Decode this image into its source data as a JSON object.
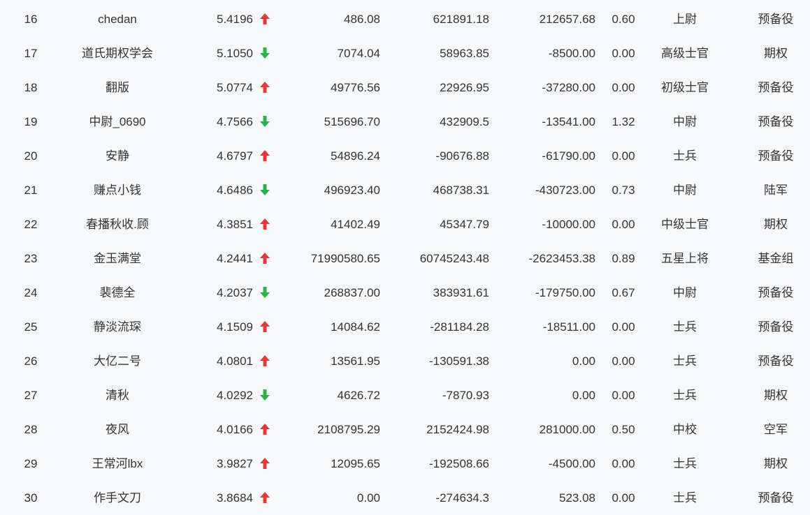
{
  "colors": {
    "up": "#e03a3a",
    "down": "#2bb34a",
    "text": "#333333",
    "background": "#f7f8fa"
  },
  "rows": [
    {
      "rank": "16",
      "name": "chedan",
      "score": "5.4196",
      "trend": "up",
      "v1": "486.08",
      "v2": "621891.18",
      "v3": "212657.68",
      "ratio": "0.60",
      "level": "上尉",
      "group": "预备役"
    },
    {
      "rank": "17",
      "name": "道氏期权学会",
      "score": "5.1050",
      "trend": "down",
      "v1": "7074.04",
      "v2": "58963.85",
      "v3": "-8500.00",
      "ratio": "0.00",
      "level": "高级士官",
      "group": "期权"
    },
    {
      "rank": "18",
      "name": "翻版",
      "score": "5.0774",
      "trend": "up",
      "v1": "49776.56",
      "v2": "22926.95",
      "v3": "-37280.00",
      "ratio": "0.00",
      "level": "初级士官",
      "group": "预备役"
    },
    {
      "rank": "19",
      "name": "中尉_0690",
      "score": "4.7566",
      "trend": "down",
      "v1": "515696.70",
      "v2": "432909.5",
      "v3": "-13541.00",
      "ratio": "1.32",
      "level": "中尉",
      "group": "预备役"
    },
    {
      "rank": "20",
      "name": "安静",
      "score": "4.6797",
      "trend": "up",
      "v1": "54896.24",
      "v2": "-90676.88",
      "v3": "-61790.00",
      "ratio": "0.00",
      "level": "士兵",
      "group": "预备役"
    },
    {
      "rank": "21",
      "name": "赚点小钱",
      "score": "4.6486",
      "trend": "down",
      "v1": "496923.40",
      "v2": "468738.31",
      "v3": "-430723.00",
      "ratio": "0.73",
      "level": "中尉",
      "group": "陆军"
    },
    {
      "rank": "22",
      "name": "春播秋收.顾",
      "score": "4.3851",
      "trend": "up",
      "v1": "41402.49",
      "v2": "45347.79",
      "v3": "-10000.00",
      "ratio": "0.00",
      "level": "中级士官",
      "group": "期权"
    },
    {
      "rank": "23",
      "name": "金玉满堂",
      "score": "4.2441",
      "trend": "up",
      "v1": "71990580.65",
      "v2": "60745243.48",
      "v3": "-2623453.38",
      "ratio": "0.89",
      "level": "五星上将",
      "group": "基金组"
    },
    {
      "rank": "24",
      "name": "裴德全",
      "score": "4.2037",
      "trend": "down",
      "v1": "268837.00",
      "v2": "383931.61",
      "v3": "-179750.00",
      "ratio": "0.67",
      "level": "中尉",
      "group": "预备役"
    },
    {
      "rank": "25",
      "name": "静淡流琛",
      "score": "4.1509",
      "trend": "up",
      "v1": "14084.62",
      "v2": "-281184.28",
      "v3": "-18511.00",
      "ratio": "0.00",
      "level": "士兵",
      "group": "预备役"
    },
    {
      "rank": "26",
      "name": "大亿二号",
      "score": "4.0801",
      "trend": "up",
      "v1": "13561.95",
      "v2": "-130591.38",
      "v3": "0.00",
      "ratio": "0.00",
      "level": "士兵",
      "group": "预备役"
    },
    {
      "rank": "27",
      "name": "清秋",
      "score": "4.0292",
      "trend": "down",
      "v1": "4626.72",
      "v2": "-7870.93",
      "v3": "0.00",
      "ratio": "0.00",
      "level": "士兵",
      "group": "期权"
    },
    {
      "rank": "28",
      "name": "夜风",
      "score": "4.0166",
      "trend": "up",
      "v1": "2108795.29",
      "v2": "2152424.98",
      "v3": "281000.00",
      "ratio": "0.50",
      "level": "中校",
      "group": "空军"
    },
    {
      "rank": "29",
      "name": "王常河lbx",
      "score": "3.9827",
      "trend": "up",
      "v1": "12095.65",
      "v2": "-192508.66",
      "v3": "-4500.00",
      "ratio": "0.00",
      "level": "士兵",
      "group": "期权"
    },
    {
      "rank": "30",
      "name": "作手文刀",
      "score": "3.8684",
      "trend": "up",
      "v1": "0.00",
      "v2": "-274634.3",
      "v3": "523.08",
      "ratio": "0.00",
      "level": "士兵",
      "group": "预备役"
    }
  ]
}
